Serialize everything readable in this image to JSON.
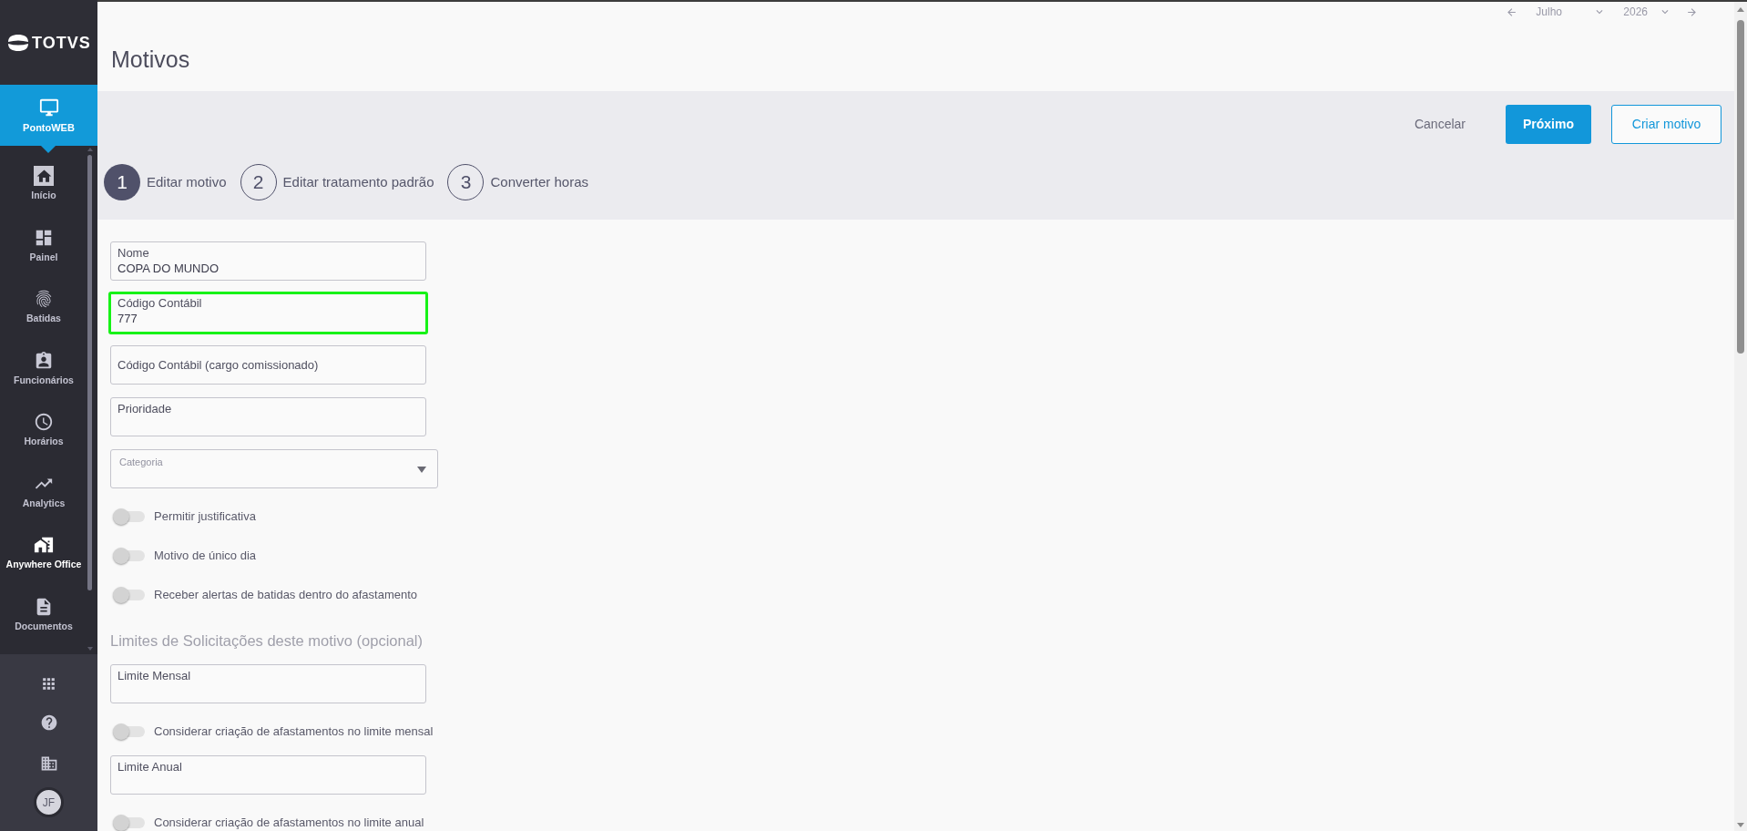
{
  "sidebar": {
    "logo_text": "TOTVS",
    "module": {
      "label": "PontoWEB",
      "selected": true
    },
    "items": [
      {
        "label": "Início",
        "highlighted": false
      },
      {
        "label": "Painel",
        "highlighted": false
      },
      {
        "label": "Batidas",
        "highlighted": false
      },
      {
        "label": "Funcionários",
        "highlighted": false
      },
      {
        "label": "Horários",
        "highlighted": false
      },
      {
        "label": "Analytics",
        "highlighted": false
      },
      {
        "label": "Anywhere Office",
        "highlighted": true
      },
      {
        "label": "Documentos",
        "highlighted": false
      }
    ],
    "avatar": {
      "initials": "JF"
    }
  },
  "period": {
    "month": "Julho",
    "year": "2026"
  },
  "page": {
    "title": "Motivos"
  },
  "actions": [
    {
      "label": "Cancelar",
      "kind": "link"
    },
    {
      "label": "Próximo",
      "kind": "primary"
    },
    {
      "label": "Criar motivo",
      "kind": "outline"
    }
  ],
  "steps": [
    {
      "number": "1",
      "label": "Editar motivo",
      "selected": true
    },
    {
      "number": "2",
      "label": "Editar tratamento padrão",
      "selected": false
    },
    {
      "number": "3",
      "label": "Converter horas",
      "selected": false
    }
  ],
  "form": [
    {
      "kind": "input",
      "label": "Nome",
      "value": "COPA DO MUNDO",
      "highlighted": false
    },
    {
      "kind": "input",
      "label": "Código Contábil",
      "value": "777",
      "highlighted": true
    },
    {
      "kind": "input",
      "placeholder": "Código Contábil (cargo comissionado)",
      "highlighted": false
    },
    {
      "kind": "input",
      "label": "Prioridade",
      "highlighted": false
    },
    {
      "kind": "select",
      "label": "Categoria"
    },
    {
      "kind": "toggle",
      "label": "Permitir justificativa",
      "on": false
    },
    {
      "kind": "toggle",
      "label": "Motivo de único dia",
      "on": false
    },
    {
      "kind": "toggle",
      "label": "Receber alertas de batidas dentro do afastamento",
      "on": false
    },
    {
      "kind": "heading",
      "label": "Limites de Solicitações deste motivo (opcional)"
    },
    {
      "kind": "input",
      "label": "Limite Mensal",
      "highlighted": false
    },
    {
      "kind": "toggle",
      "label": "Considerar criação de afastamentos no limite mensal",
      "on": false
    },
    {
      "kind": "input",
      "label": "Limite Anual",
      "highlighted": false
    },
    {
      "kind": "toggle",
      "label": "Considerar criação de afastamentos no limite anual",
      "on": false
    }
  ]
}
